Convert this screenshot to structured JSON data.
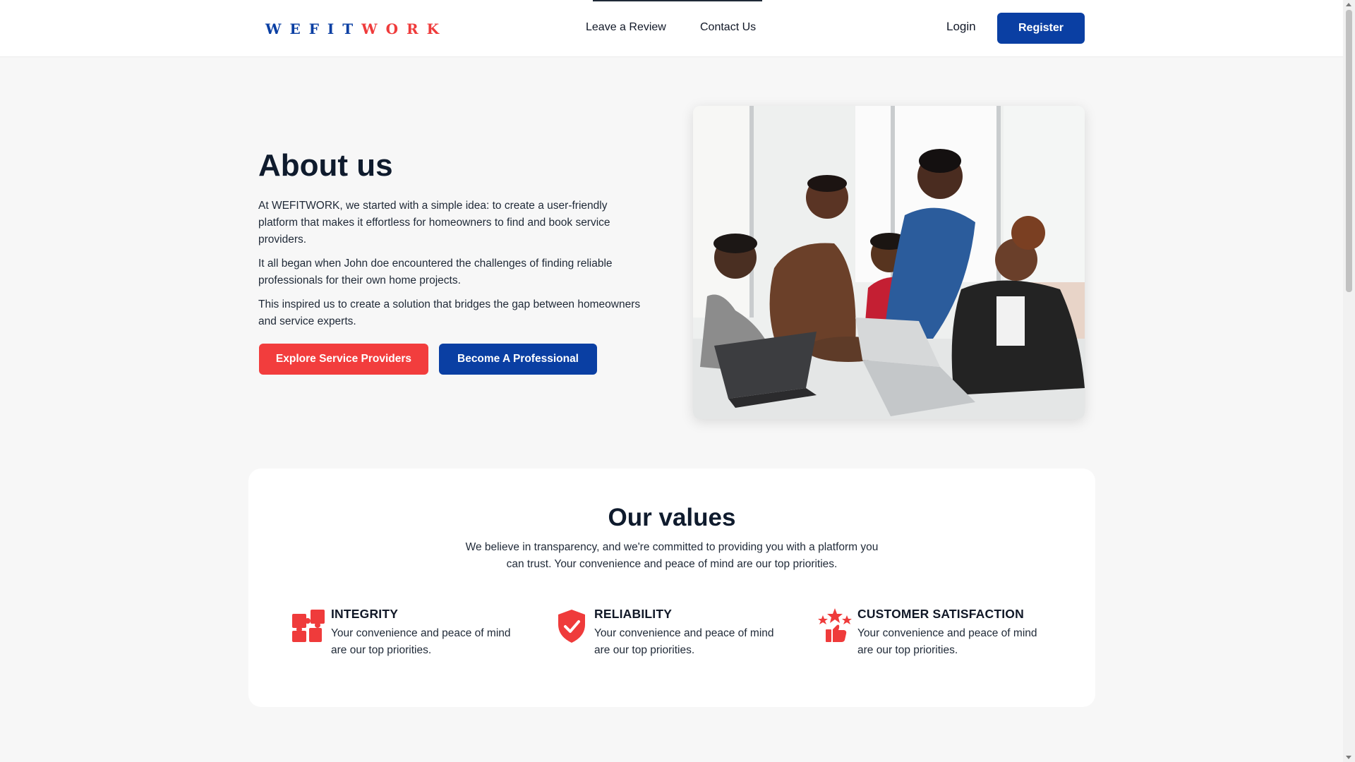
{
  "header": {
    "logo_part1": "WEFIT",
    "logo_part2": "WORK",
    "nav": [
      "Leave a Review",
      "Contact Us"
    ],
    "login": "Login",
    "register": "Register"
  },
  "about": {
    "title": "About us",
    "paragraphs": [
      "At WEFITWORK, we started with a simple idea: to create a user-friendly platform that makes it effortless for homeowners to find and book service providers.",
      "It all began when John doe encountered the challenges of finding reliable professionals for their own home projects.",
      "This inspired us to create a solution that bridges the gap between homeowners and service experts."
    ],
    "buttons": {
      "explore": "Explore Service Providers",
      "become": "Become A Professional"
    }
  },
  "values": {
    "title": "Our values",
    "subtitle": "We believe in transparency, and we're committed to providing you with a platform you can trust. Your convenience and peace of mind are our top priorities.",
    "items": [
      {
        "name": "INTEGRITY",
        "desc": "Your convenience and peace of mind are our top priorities.",
        "icon": "puzzle-icon"
      },
      {
        "name": "RELIABILITY",
        "desc": "Your convenience and peace of mind are our top priorities.",
        "icon": "shield-check-icon"
      },
      {
        "name": "CUSTOMER SATISFACTION",
        "desc": "Your convenience and peace of mind are our top priorities.",
        "icon": "thumbs-up-stars-icon"
      }
    ]
  },
  "colors": {
    "brand_blue": "#0a3fa3",
    "accent_red": "#ef3b3b",
    "background": "#f7f7f7"
  }
}
